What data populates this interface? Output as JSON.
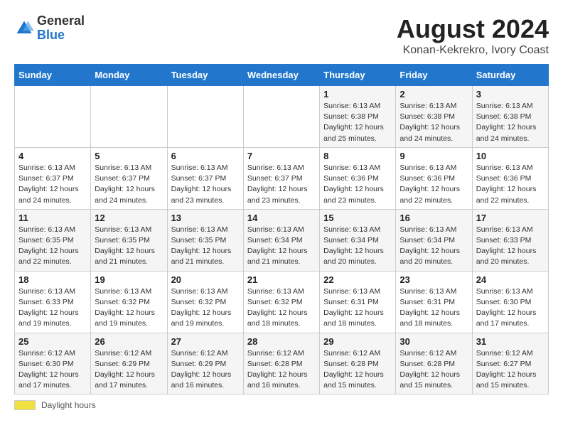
{
  "logo": {
    "general": "General",
    "blue": "Blue"
  },
  "title": "August 2024",
  "location": "Konan-Kekrekro, Ivory Coast",
  "days_of_week": [
    "Sunday",
    "Monday",
    "Tuesday",
    "Wednesday",
    "Thursday",
    "Friday",
    "Saturday"
  ],
  "weeks": [
    [
      {
        "day": "",
        "info": ""
      },
      {
        "day": "",
        "info": ""
      },
      {
        "day": "",
        "info": ""
      },
      {
        "day": "",
        "info": ""
      },
      {
        "day": "1",
        "info": "Sunrise: 6:13 AM\nSunset: 6:38 PM\nDaylight: 12 hours and 25 minutes."
      },
      {
        "day": "2",
        "info": "Sunrise: 6:13 AM\nSunset: 6:38 PM\nDaylight: 12 hours and 24 minutes."
      },
      {
        "day": "3",
        "info": "Sunrise: 6:13 AM\nSunset: 6:38 PM\nDaylight: 12 hours and 24 minutes."
      }
    ],
    [
      {
        "day": "4",
        "info": "Sunrise: 6:13 AM\nSunset: 6:37 PM\nDaylight: 12 hours and 24 minutes."
      },
      {
        "day": "5",
        "info": "Sunrise: 6:13 AM\nSunset: 6:37 PM\nDaylight: 12 hours and 24 minutes."
      },
      {
        "day": "6",
        "info": "Sunrise: 6:13 AM\nSunset: 6:37 PM\nDaylight: 12 hours and 23 minutes."
      },
      {
        "day": "7",
        "info": "Sunrise: 6:13 AM\nSunset: 6:37 PM\nDaylight: 12 hours and 23 minutes."
      },
      {
        "day": "8",
        "info": "Sunrise: 6:13 AM\nSunset: 6:36 PM\nDaylight: 12 hours and 23 minutes."
      },
      {
        "day": "9",
        "info": "Sunrise: 6:13 AM\nSunset: 6:36 PM\nDaylight: 12 hours and 22 minutes."
      },
      {
        "day": "10",
        "info": "Sunrise: 6:13 AM\nSunset: 6:36 PM\nDaylight: 12 hours and 22 minutes."
      }
    ],
    [
      {
        "day": "11",
        "info": "Sunrise: 6:13 AM\nSunset: 6:35 PM\nDaylight: 12 hours and 22 minutes."
      },
      {
        "day": "12",
        "info": "Sunrise: 6:13 AM\nSunset: 6:35 PM\nDaylight: 12 hours and 21 minutes."
      },
      {
        "day": "13",
        "info": "Sunrise: 6:13 AM\nSunset: 6:35 PM\nDaylight: 12 hours and 21 minutes."
      },
      {
        "day": "14",
        "info": "Sunrise: 6:13 AM\nSunset: 6:34 PM\nDaylight: 12 hours and 21 minutes."
      },
      {
        "day": "15",
        "info": "Sunrise: 6:13 AM\nSunset: 6:34 PM\nDaylight: 12 hours and 20 minutes."
      },
      {
        "day": "16",
        "info": "Sunrise: 6:13 AM\nSunset: 6:34 PM\nDaylight: 12 hours and 20 minutes."
      },
      {
        "day": "17",
        "info": "Sunrise: 6:13 AM\nSunset: 6:33 PM\nDaylight: 12 hours and 20 minutes."
      }
    ],
    [
      {
        "day": "18",
        "info": "Sunrise: 6:13 AM\nSunset: 6:33 PM\nDaylight: 12 hours and 19 minutes."
      },
      {
        "day": "19",
        "info": "Sunrise: 6:13 AM\nSunset: 6:32 PM\nDaylight: 12 hours and 19 minutes."
      },
      {
        "day": "20",
        "info": "Sunrise: 6:13 AM\nSunset: 6:32 PM\nDaylight: 12 hours and 19 minutes."
      },
      {
        "day": "21",
        "info": "Sunrise: 6:13 AM\nSunset: 6:32 PM\nDaylight: 12 hours and 18 minutes."
      },
      {
        "day": "22",
        "info": "Sunrise: 6:13 AM\nSunset: 6:31 PM\nDaylight: 12 hours and 18 minutes."
      },
      {
        "day": "23",
        "info": "Sunrise: 6:13 AM\nSunset: 6:31 PM\nDaylight: 12 hours and 18 minutes."
      },
      {
        "day": "24",
        "info": "Sunrise: 6:13 AM\nSunset: 6:30 PM\nDaylight: 12 hours and 17 minutes."
      }
    ],
    [
      {
        "day": "25",
        "info": "Sunrise: 6:12 AM\nSunset: 6:30 PM\nDaylight: 12 hours and 17 minutes."
      },
      {
        "day": "26",
        "info": "Sunrise: 6:12 AM\nSunset: 6:29 PM\nDaylight: 12 hours and 17 minutes."
      },
      {
        "day": "27",
        "info": "Sunrise: 6:12 AM\nSunset: 6:29 PM\nDaylight: 12 hours and 16 minutes."
      },
      {
        "day": "28",
        "info": "Sunrise: 6:12 AM\nSunset: 6:28 PM\nDaylight: 12 hours and 16 minutes."
      },
      {
        "day": "29",
        "info": "Sunrise: 6:12 AM\nSunset: 6:28 PM\nDaylight: 12 hours and 15 minutes."
      },
      {
        "day": "30",
        "info": "Sunrise: 6:12 AM\nSunset: 6:28 PM\nDaylight: 12 hours and 15 minutes."
      },
      {
        "day": "31",
        "info": "Sunrise: 6:12 AM\nSunset: 6:27 PM\nDaylight: 12 hours and 15 minutes."
      }
    ]
  ],
  "footer": {
    "daylight_label": "Daylight hours"
  }
}
